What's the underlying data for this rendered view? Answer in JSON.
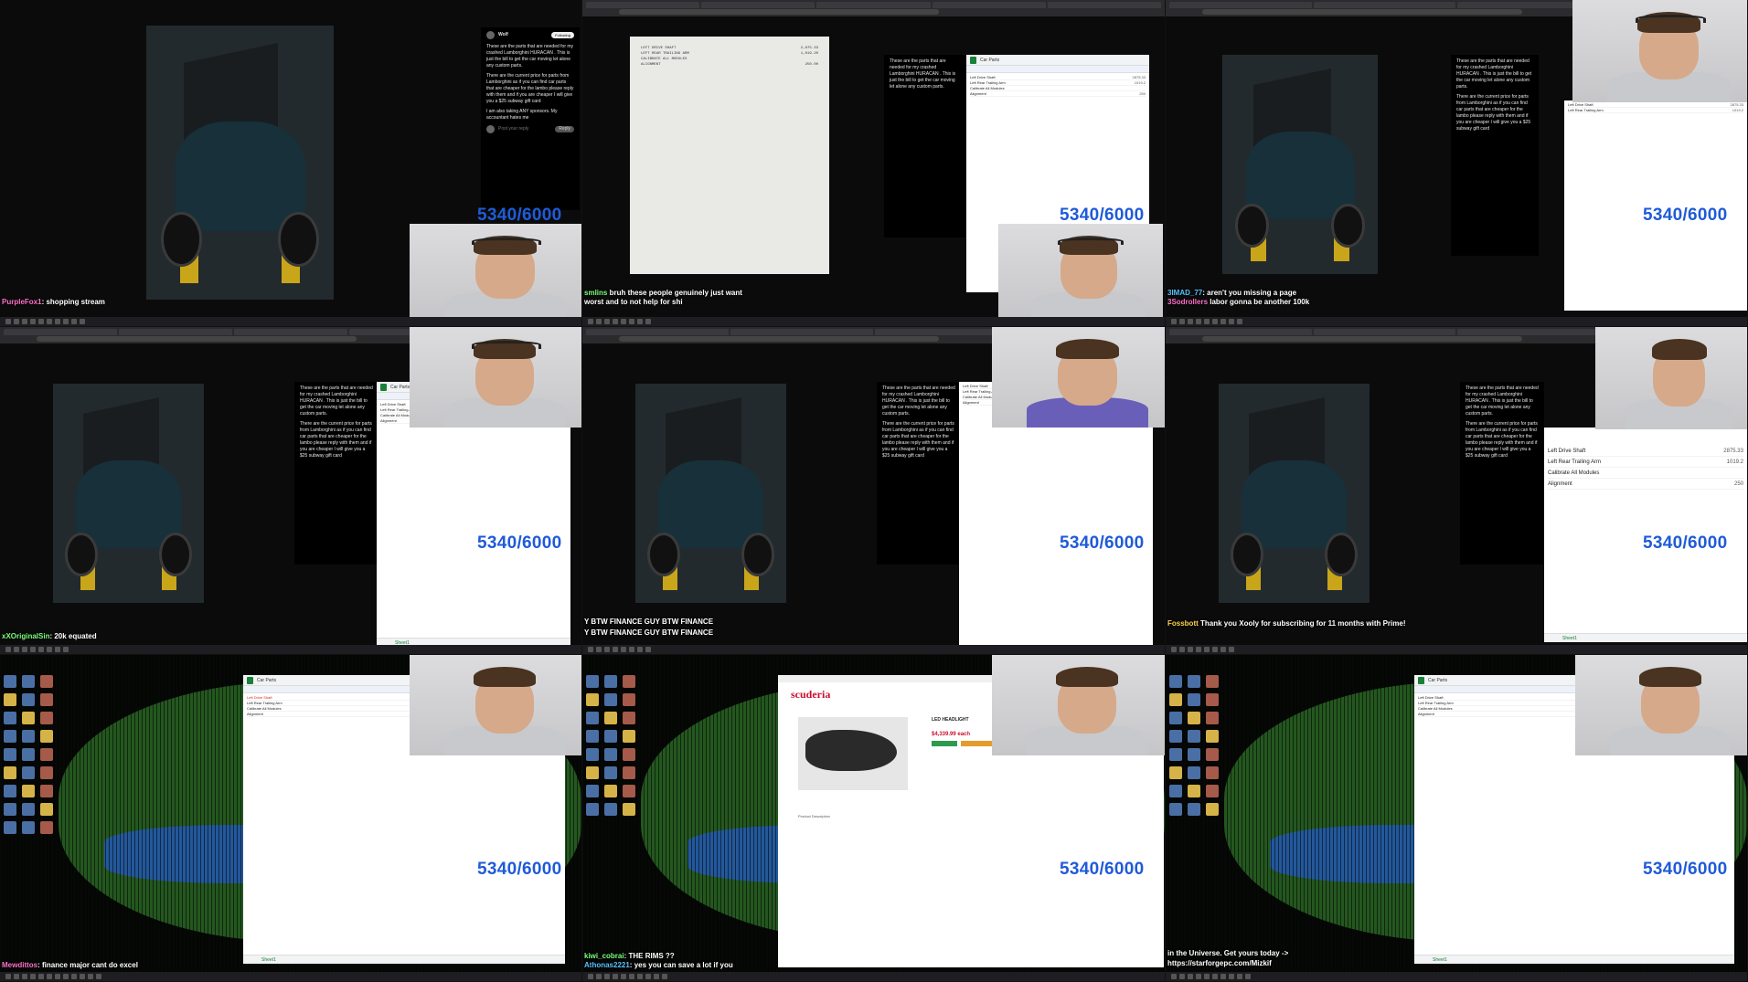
{
  "counter_text": "5340/6000",
  "tweet": {
    "author": "Wolf",
    "follow_label": "Following",
    "body_1": "These are the parts that are needed for my crashed Lamborghini HURACAN . This is just the bill to get the car moving let alone any custom parts.",
    "body_2": "There are the current price for parts from Lamborghini as if you can find car parts that are cheaper for the lambo please reply with them and if you are cheaper I will give you a $25 subway gift card",
    "body_3": "I am also taking ANY sponsors. My accountant hates me",
    "reply_placeholder": "Post your reply",
    "reply_button": "Reply"
  },
  "sheet": {
    "title": "Car Parts",
    "tab_name": "Sheet1",
    "rows": [
      {
        "label": "Left Drive Shaft",
        "value": "2875.33"
      },
      {
        "label": "Left Rear Trailing Arm",
        "value": "1019.2"
      },
      {
        "label": "Calibrate All Modules",
        "value": ""
      },
      {
        "label": "Alignment",
        "value": "250"
      }
    ]
  },
  "store": {
    "logo": "scuderia",
    "product_title": "LED HEADLIGHT",
    "price": "$4,339.99 each",
    "description": "Product Description"
  },
  "chat": [
    {
      "user": "PurpleFox1",
      "msg": "shopping stream"
    },
    {
      "user": "smlins",
      "msg": "bruh these people genuinely just want"
    },
    {
      "user": "3IMAD_77",
      "msg": "aren't you missing a page"
    },
    {
      "user": "xXOriginalSin",
      "msg": "20k equated"
    },
    {
      "user": "",
      "msg": "Y BTW FINANCE GUY BTW FINANCE"
    },
    {
      "user": "Fossbott",
      "msg": "Thank you Xooly for subscribing for 11 months with Prime!"
    },
    {
      "user": "Mewdittos",
      "msg": "finance major cant do excel"
    },
    {
      "user": "Athonas2221",
      "msg": "yes you can save a lot if you"
    },
    {
      "user": "",
      "msg": "in the Universe. Get yours today ->"
    }
  ],
  "chat2": [
    {
      "user": "",
      "msg": "worst and to not help for shi"
    },
    {
      "user": "3Sodrollers",
      "msg": "labor gonna be another 100k"
    },
    {
      "user": "",
      "msg": "Y BTW FINANCE GUY BTW FINANCE"
    },
    {
      "user": "kiwi_cobrai",
      "msg": "THE RIMS ??"
    },
    {
      "user": "",
      "msg": "https://starforgepc.com/Mizkif"
    }
  ],
  "colors": {
    "counter": "#1f5bd8",
    "sheets_green": "#188038",
    "store_red": "#c8102e"
  },
  "icons": {
    "avatar": "avatar-icon",
    "reply": "reply-icon",
    "sheets": "sheets-logo-icon"
  }
}
